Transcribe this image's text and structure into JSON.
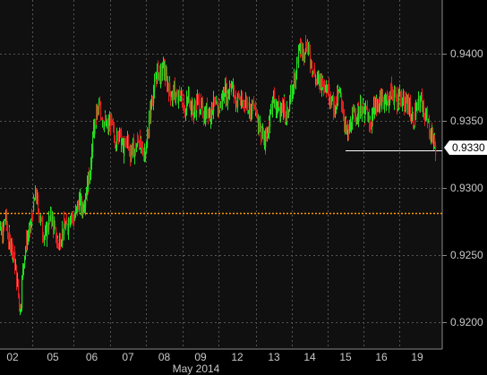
{
  "chart_data": {
    "type": "candlestick",
    "ylim": [
      0.918,
      0.944
    ],
    "yticks": [
      {
        "value": 0.94,
        "label": "0.9400"
      },
      {
        "value": 0.935,
        "label": "0.9350"
      },
      {
        "value": 0.93,
        "label": "0.9300"
      },
      {
        "value": 0.925,
        "label": "0.9250"
      },
      {
        "value": 0.92,
        "label": "0.9200"
      }
    ],
    "x_tick_labels": [
      "02",
      "05",
      "06",
      "07",
      "08",
      "09",
      "12",
      "13",
      "14",
      "15",
      "16",
      "19"
    ],
    "x_secondary_label": "May 2014",
    "reference_level": 0.9281,
    "support_level": 0.9328,
    "last_price": {
      "value": 0.933,
      "label": "0.9330"
    },
    "colors": {
      "up": "#22dd22",
      "down": "#e02020",
      "reference": "#ff9900",
      "grid": "#555555",
      "support": "#ffffff"
    },
    "series": [
      {
        "day": "02",
        "points": [
          0.9272,
          0.9279,
          0.9268,
          0.9265,
          0.928,
          0.9262,
          0.9258,
          0.9248,
          0.9228,
          0.9208,
          0.9245,
          0.9262,
          0.9266,
          0.9283
        ]
      },
      {
        "day": "05",
        "points": [
          0.9283,
          0.9296,
          0.9282,
          0.927,
          0.9262,
          0.9274,
          0.9279,
          0.9268,
          0.9258,
          0.9264,
          0.9273,
          0.927,
          0.9282,
          0.9276
        ]
      },
      {
        "day": "06",
        "points": [
          0.9276,
          0.9283,
          0.929,
          0.9285,
          0.9293,
          0.9303,
          0.9318,
          0.934,
          0.9355,
          0.936,
          0.9353,
          0.9348,
          0.9344,
          0.935
        ]
      },
      {
        "day": "07",
        "points": [
          0.935,
          0.9342,
          0.9335,
          0.9344,
          0.9332,
          0.9328,
          0.9338,
          0.9325,
          0.9332,
          0.9327,
          0.9339,
          0.933,
          0.9326,
          0.933
        ]
      },
      {
        "day": "08",
        "points": [
          0.933,
          0.9352,
          0.9365,
          0.9377,
          0.9388,
          0.9383,
          0.9391,
          0.9381,
          0.9375,
          0.9368,
          0.9372,
          0.9365,
          0.937,
          0.9364
        ]
      },
      {
        "day": "09",
        "points": [
          0.9364,
          0.9358,
          0.937,
          0.936,
          0.9356,
          0.9365,
          0.9362,
          0.9358,
          0.9353,
          0.936,
          0.9354,
          0.9363,
          0.9358,
          0.936
        ]
      },
      {
        "day": "12",
        "points": [
          0.936,
          0.9365,
          0.9374,
          0.9368,
          0.9379,
          0.9372,
          0.9364,
          0.9368,
          0.936,
          0.9366,
          0.9362,
          0.9358,
          0.9361,
          0.9356
        ]
      },
      {
        "day": "13",
        "points": [
          0.9356,
          0.9348,
          0.934,
          0.9333,
          0.9342,
          0.9355,
          0.9368,
          0.9358,
          0.9362,
          0.9355,
          0.936,
          0.9352,
          0.9365,
          0.9372
        ]
      },
      {
        "day": "14",
        "points": [
          0.9372,
          0.9385,
          0.9398,
          0.9405,
          0.94,
          0.9409,
          0.9401,
          0.9392,
          0.9385,
          0.9378,
          0.9382,
          0.9376,
          0.938,
          0.9373
        ]
      },
      {
        "day": "15",
        "points": [
          0.9373,
          0.9368,
          0.936,
          0.9365,
          0.937,
          0.9364,
          0.935,
          0.9338,
          0.9345,
          0.9352,
          0.9358,
          0.9355,
          0.936,
          0.9354
        ]
      },
      {
        "day": "16",
        "points": [
          0.9354,
          0.9358,
          0.9346,
          0.9352,
          0.9362,
          0.936,
          0.9366,
          0.9362,
          0.9368,
          0.9364,
          0.9373,
          0.9368,
          0.9365,
          0.937
        ]
      },
      {
        "day": "19",
        "points": [
          0.937,
          0.9364,
          0.936,
          0.9365,
          0.9355,
          0.935,
          0.9358,
          0.9362,
          0.9366,
          0.9356,
          0.935,
          0.9343,
          0.9338,
          0.933
        ]
      }
    ]
  }
}
